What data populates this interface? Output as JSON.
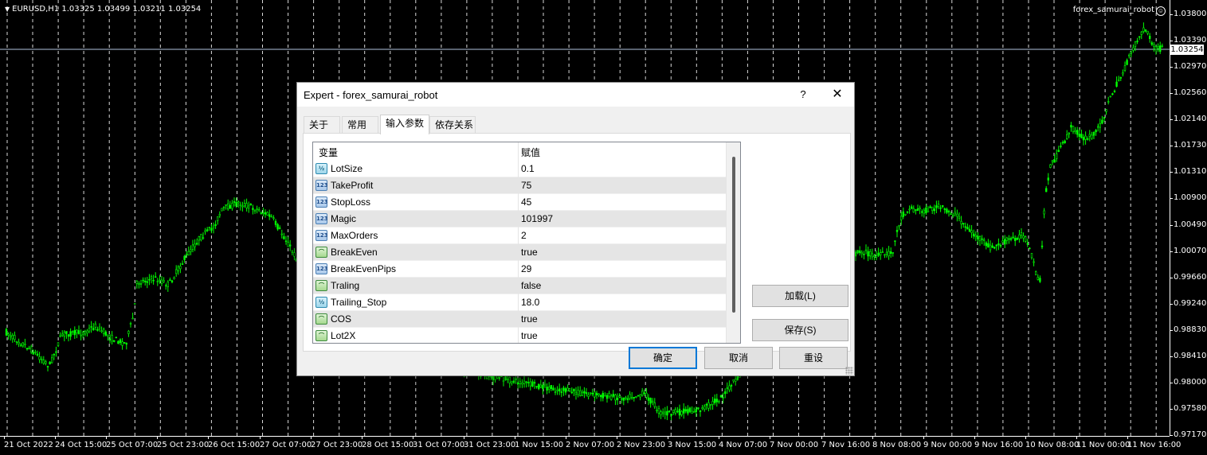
{
  "chart": {
    "symbol_info": "EURUSD,H1  1.03325 1.03499 1.03211 1.03254",
    "expert_name": "forex_samurai_robot",
    "current_price": "1.03254",
    "price_labels": [
      "1.03800",
      "1.03390",
      "1.02970",
      "1.02560",
      "1.02140",
      "1.01730",
      "1.01310",
      "1.00900",
      "1.00490",
      "1.00070",
      "0.99660",
      "0.99240",
      "0.98830",
      "0.98410",
      "0.98000",
      "0.97580",
      "0.97170"
    ],
    "time_labels": [
      "21 Oct 2022",
      "24 Oct 15:00",
      "25 Oct 07:00",
      "25 Oct 23:00",
      "26 Oct 15:00",
      "27 Oct 07:00",
      "27 Oct 23:00",
      "28 Oct 15:00",
      "31 Oct 07:00",
      "31 Oct 23:00",
      "1 Nov 15:00",
      "2 Nov 07:00",
      "2 Nov 23:00",
      "3 Nov 15:00",
      "4 Nov 07:00",
      "7 Nov 00:00",
      "7 Nov 16:00",
      "8 Nov 08:00",
      "9 Nov 00:00",
      "9 Nov 16:00",
      "10 Nov 08:00",
      "11 Nov 00:00",
      "11 Nov 16:00"
    ],
    "colors": {
      "background": "#000000",
      "candles": "#00ff00",
      "grid": "#ffffff",
      "current_price_line": "#b0c4de"
    },
    "smiley_icon": "smiley-icon"
  },
  "dialog": {
    "title": "Expert - forex_samurai_robot",
    "help_label": "?",
    "close_label": "✕",
    "tabs": [
      {
        "label": "关于",
        "active": false
      },
      {
        "label": "常用",
        "active": false
      },
      {
        "label": "输入参数",
        "active": true
      },
      {
        "label": "依存关系",
        "active": false
      }
    ],
    "table": {
      "col_variable": "变量",
      "col_value": "赋值",
      "rows": [
        {
          "icon": "double-param-icon",
          "icon_text": "½",
          "name": "LotSize",
          "value": "0.1"
        },
        {
          "icon": "int-param-icon",
          "icon_text": "123",
          "name": "TakeProfit",
          "value": "75"
        },
        {
          "icon": "int-param-icon",
          "icon_text": "123",
          "name": "StopLoss",
          "value": "45"
        },
        {
          "icon": "int-param-icon",
          "icon_text": "123",
          "name": "Magic",
          "value": "101997"
        },
        {
          "icon": "int-param-icon",
          "icon_text": "123",
          "name": "MaxOrders",
          "value": "2"
        },
        {
          "icon": "bool-param-icon",
          "icon_text": "⌒",
          "name": "BreakEven",
          "value": "true"
        },
        {
          "icon": "int-param-icon",
          "icon_text": "123",
          "name": "BreakEvenPips",
          "value": "29"
        },
        {
          "icon": "bool-param-icon",
          "icon_text": "⌒",
          "name": "Traling",
          "value": "false"
        },
        {
          "icon": "double-param-icon",
          "icon_text": "½",
          "name": "Trailing_Stop",
          "value": "18.0"
        },
        {
          "icon": "bool-param-icon",
          "icon_text": "⌒",
          "name": "COS",
          "value": "true"
        },
        {
          "icon": "bool-param-icon",
          "icon_text": "⌒",
          "name": "Lot2X",
          "value": "true"
        }
      ]
    },
    "buttons": {
      "load": "加载(L)",
      "save": "保存(S)",
      "ok": "确定",
      "cancel": "取消",
      "reset": "重设"
    }
  }
}
